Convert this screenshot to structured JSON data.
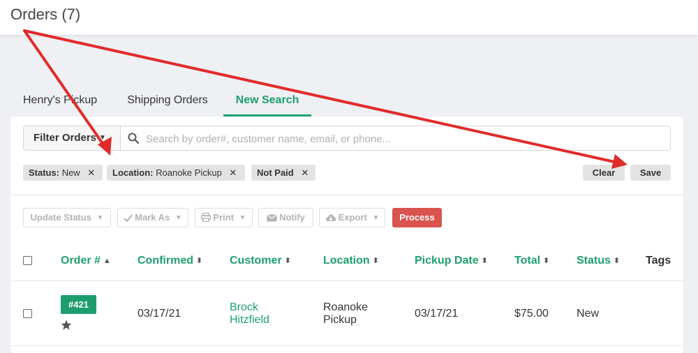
{
  "header": {
    "title": "Orders (7)"
  },
  "tabs": [
    {
      "label": "Henry's Pickup"
    },
    {
      "label": "Shipping Orders"
    },
    {
      "label": "New Search"
    }
  ],
  "filter": {
    "button_label": "Filter Orders",
    "search_placeholder": "Search by order#, customer name, email, or phone...",
    "search_value": ""
  },
  "chips": [
    {
      "key": "Status:",
      "value": "New"
    },
    {
      "key": "Location:",
      "value": "Roanoke Pickup"
    },
    {
      "key": "Not Paid",
      "value": ""
    }
  ],
  "buttons": {
    "clear": "Clear",
    "save": "Save"
  },
  "actions": {
    "update_status": "Update Status",
    "mark_as": "Mark As",
    "print": "Print",
    "notify": "Notify",
    "export": "Export",
    "process": "Process"
  },
  "table": {
    "columns": [
      "Order #",
      "Confirmed",
      "Customer",
      "Location",
      "Pickup Date",
      "Total",
      "Status",
      "Tags"
    ],
    "rows": [
      {
        "order": "#421",
        "starred": true,
        "confirmed": "03/17/21",
        "customer_line1": "Brock",
        "customer_line2": "Hitzfield",
        "location_line1": "Roanoke",
        "location_line2": "Pickup",
        "pickup_date": "03/17/21",
        "total": "$75.00",
        "status": "New",
        "tags": ""
      }
    ]
  },
  "colors": {
    "accent": "#1e9e6e",
    "process": "#d9534f",
    "annotation_arrow": "#e02b2b",
    "background": "#eef0f4"
  },
  "icons": [
    "search-icon",
    "chevron-down-icon",
    "close-icon",
    "check-icon",
    "print-icon",
    "envelope-icon",
    "cloud-download-icon",
    "sort-icon",
    "star-icon",
    "annotation-arrow"
  ]
}
